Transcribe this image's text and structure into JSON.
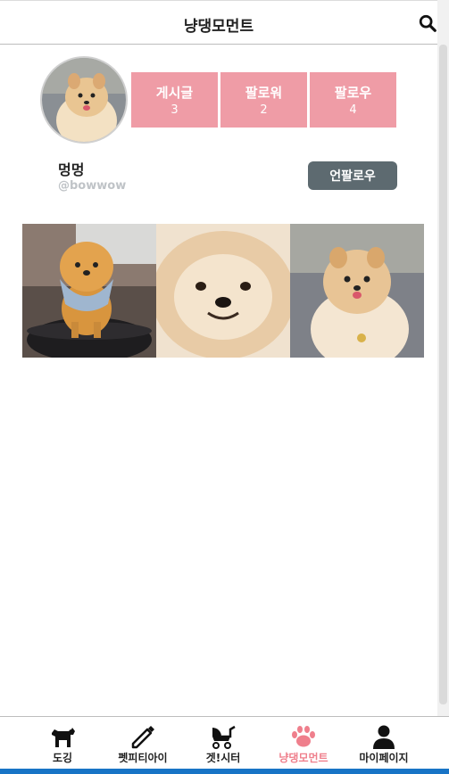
{
  "header": {
    "title": "냥댕모먼트"
  },
  "profile": {
    "name": "멍멍",
    "handle": "@bowwow",
    "unfollow_label": "언팔로우",
    "stats": [
      {
        "label": "게시글",
        "value": "3"
      },
      {
        "label": "팔로워",
        "value": "2"
      },
      {
        "label": "팔로우",
        "value": "4"
      }
    ]
  },
  "nav": [
    {
      "label": "도깅",
      "icon": "dog-icon"
    },
    {
      "label": "펫피티아이",
      "icon": "pencil-icon"
    },
    {
      "label": "겟!시터",
      "icon": "stroller-icon"
    },
    {
      "label": "냥댕모먼트",
      "icon": "paw-icon"
    },
    {
      "label": "마이페이지",
      "icon": "user-icon"
    }
  ],
  "colors": {
    "accent": "#ef9ca6",
    "active_nav": "#ef7f8c",
    "button": "#5d6a70"
  }
}
